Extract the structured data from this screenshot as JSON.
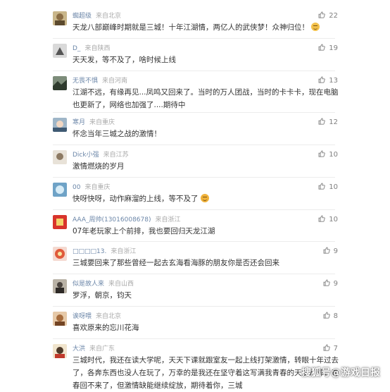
{
  "comments": [
    {
      "user": "蜘超级",
      "source": "来自北京",
      "likes": "22",
      "text": "天龙八部巅峰时期就是三城！十年江湖情，两亿人的武侠梦！众神归位！",
      "emoji": "smile"
    },
    {
      "user": "D_",
      "source": "来自陕西",
      "likes": "19",
      "text": "天天发，等不及了，啥时候上线"
    },
    {
      "user": "无畏不惧",
      "source": "来自河南",
      "likes": "13",
      "text": "江湖不远，有缘再见...凤鸣又回来了。当时的万人团战，当时的卡卡卡，现在电脑也更新了，网络也加强了....期待中"
    },
    {
      "user": "寒月",
      "source": "来自重庆",
      "likes": "12",
      "text": "怀念当年三城之战的激情！"
    },
    {
      "user": "Dick小强",
      "source": "来自江苏",
      "likes": "10",
      "text": "激情燃烧的岁月"
    },
    {
      "user": "00",
      "source": "来自重庆",
      "likes": "10",
      "text": "快呀快呀，动作麻溜的上线，等不及了",
      "emoji": "grin"
    },
    {
      "user": "AAA_周帅(13016008678)",
      "source": "来自浙江",
      "likes": "10",
      "text": "07年老玩家上个前排，我也要回归天龙江湖"
    },
    {
      "user": "□□□□13.",
      "source": "来自浙江",
      "likes": "9",
      "text": "三城要回来了那些曾经一起去玄海看海豚的朋友你是否还会回来"
    },
    {
      "user": "似是故人来",
      "source": "来自山西",
      "likes": "9",
      "text": "罗浮，朝京，钧天"
    },
    {
      "user": "诶呀喂",
      "source": "来自北京",
      "likes": "8",
      "text": "喜欢原来的忘川花海"
    },
    {
      "user": "大洪",
      "source": "来自广东",
      "likes": "7",
      "text": "三城时代，我还在读大学呢，天天下课就跟室友一起上线打架激情，转眼十年过去了，各奔东西也没人在玩了，万幸的是我还在坚守着这写满我青春的天龙八部，青春回不来了，但激情缺能继续绽放，期待着你，三城"
    }
  ],
  "watermark": "搜狐号@游戏日报",
  "colors": {
    "username": "#6b86a8",
    "source": "#a9a9a9",
    "text": "#333333",
    "likes": "#7f7f7f"
  }
}
